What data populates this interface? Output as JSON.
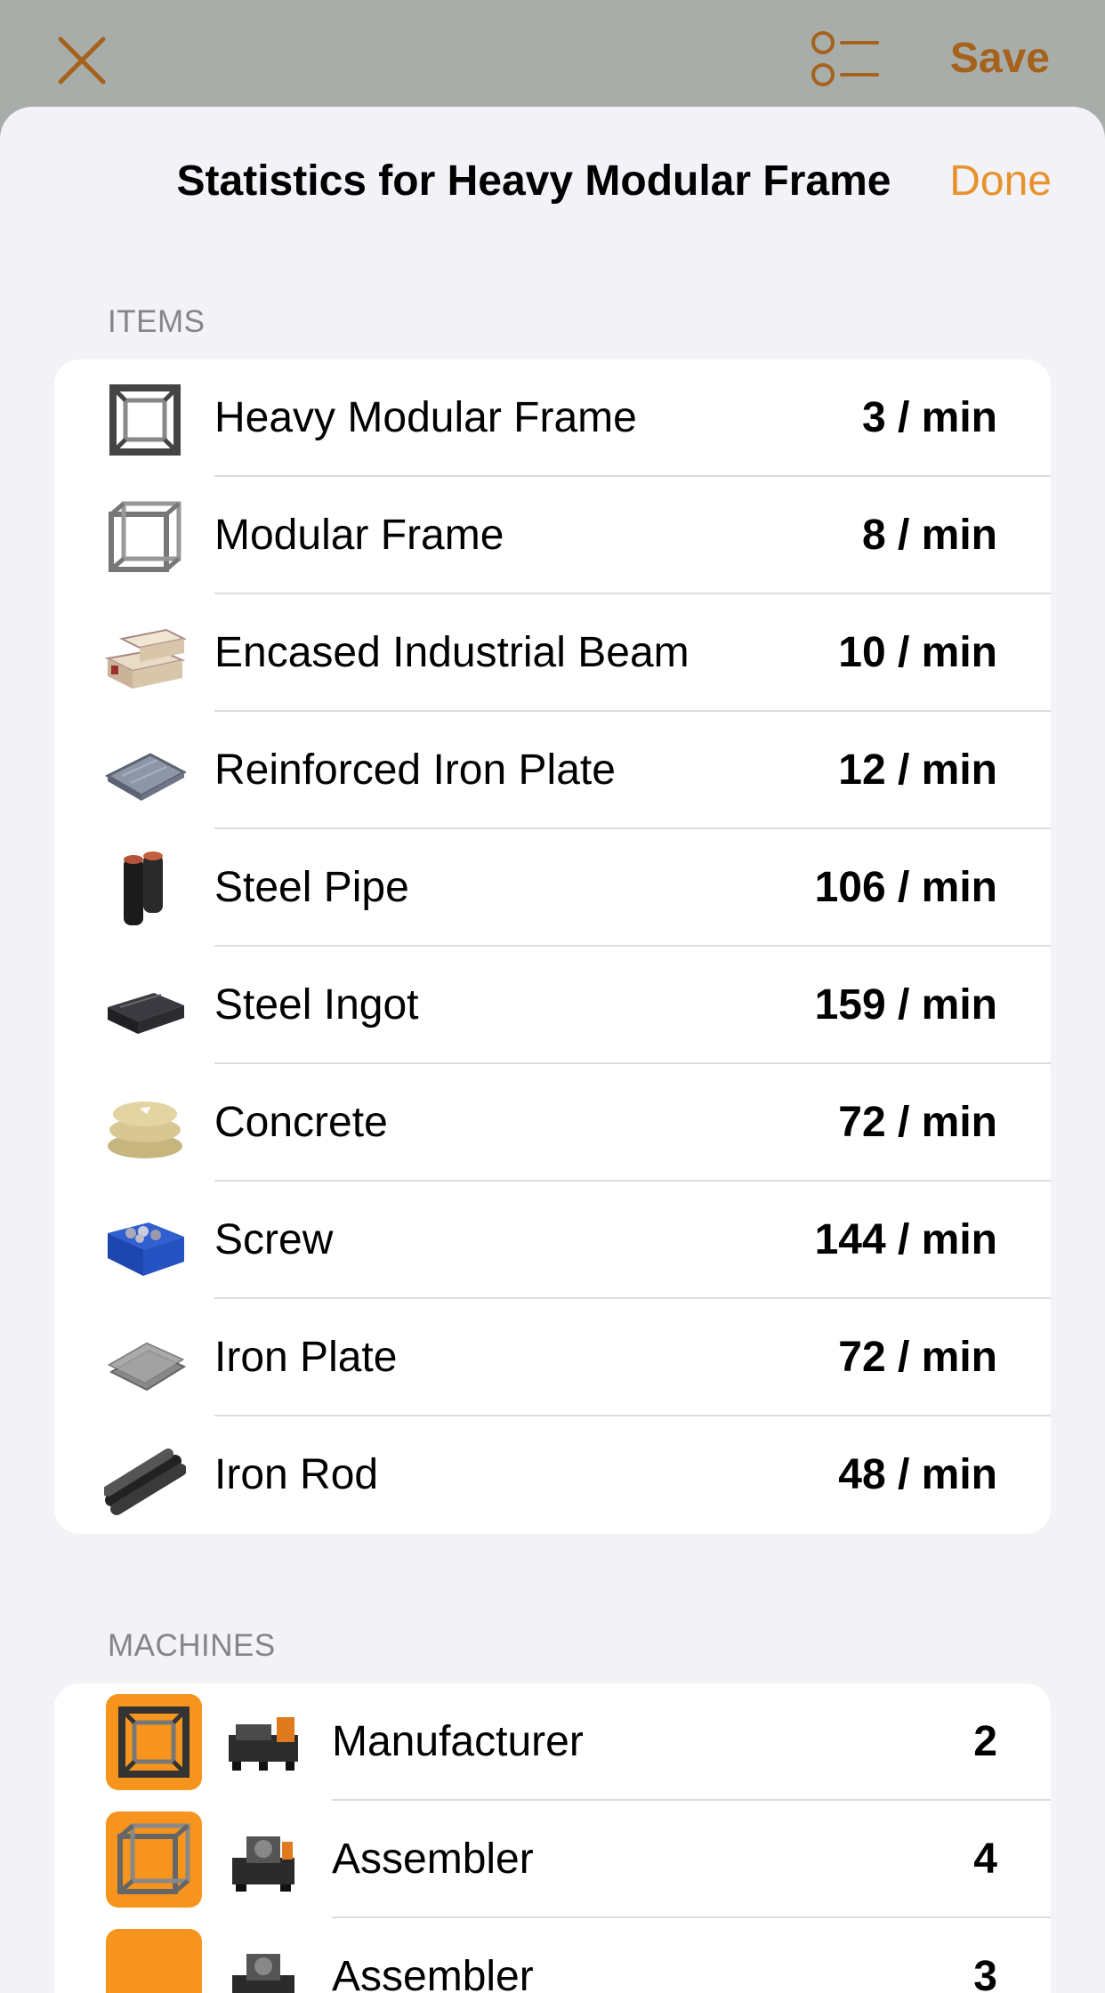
{
  "toolbar": {
    "save_label": "Save"
  },
  "sheet": {
    "title": "Statistics for Heavy Modular Frame",
    "done_label": "Done"
  },
  "items_section": {
    "header": "ITEMS",
    "rows": [
      {
        "label": "Heavy Modular Frame",
        "rate": "3 / min",
        "icon": "heavy-modular-frame-icon"
      },
      {
        "label": "Modular Frame",
        "rate": "8 / min",
        "icon": "modular-frame-icon"
      },
      {
        "label": "Encased Industrial Beam",
        "rate": "10 / min",
        "icon": "encased-industrial-beam-icon"
      },
      {
        "label": "Reinforced Iron Plate",
        "rate": "12 / min",
        "icon": "reinforced-iron-plate-icon"
      },
      {
        "label": "Steel Pipe",
        "rate": "106 / min",
        "icon": "steel-pipe-icon"
      },
      {
        "label": "Steel Ingot",
        "rate": "159 / min",
        "icon": "steel-ingot-icon"
      },
      {
        "label": "Concrete",
        "rate": "72 / min",
        "icon": "concrete-icon"
      },
      {
        "label": "Screw",
        "rate": "144 / min",
        "icon": "screw-icon"
      },
      {
        "label": "Iron Plate",
        "rate": "72 / min",
        "icon": "iron-plate-icon"
      },
      {
        "label": "Iron Rod",
        "rate": "48 / min",
        "icon": "iron-rod-icon"
      }
    ]
  },
  "machines_section": {
    "header": "MACHINES",
    "rows": [
      {
        "label": "Manufacturer",
        "count": "2",
        "icon": "manufacturer-icon"
      },
      {
        "label": "Assembler",
        "count": "4",
        "icon": "assembler-icon"
      },
      {
        "label": "Assembler",
        "count": "3",
        "icon": "assembler-icon"
      }
    ]
  },
  "colors": {
    "accent": "#e8922e",
    "save": "#a4621c",
    "tile": "#f7941d"
  }
}
